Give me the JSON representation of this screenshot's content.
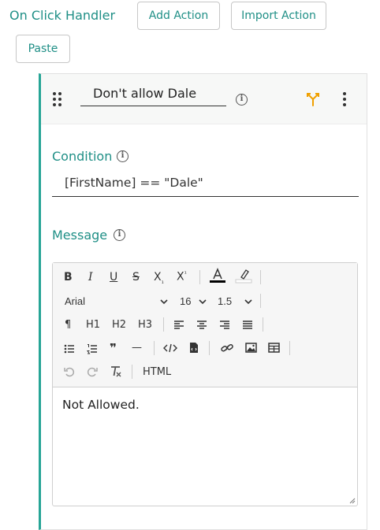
{
  "header": {
    "title": "On Click Handler",
    "add_action_label": "Add Action",
    "import_action_label": "Import Action",
    "paste_label": "Paste"
  },
  "action": {
    "name": "Don't allow Dale",
    "condition_label": "Condition",
    "condition_value": "[FirstName] == \"Dale\"",
    "message_label": "Message"
  },
  "editor": {
    "font_family": "Arial",
    "font_size": "16",
    "line_height": "1.5",
    "headings": [
      "H1",
      "H2",
      "H3"
    ],
    "html_label": "HTML",
    "content": "Not Allowed."
  },
  "colors": {
    "accent": "#1f8f86",
    "card_border": "#27a596",
    "branch_icon": "#f0a000"
  },
  "icons": {
    "drag": "drag-handle-icon",
    "info": "info-icon",
    "branch": "branch-icon",
    "more": "more-vertical-icon"
  }
}
